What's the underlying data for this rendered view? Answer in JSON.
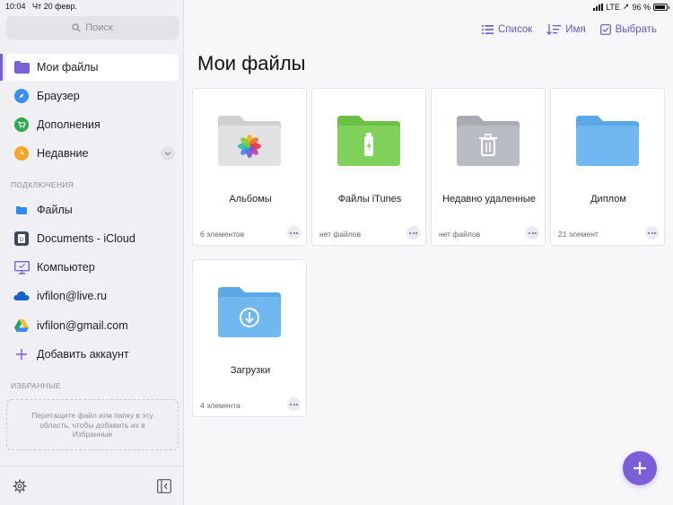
{
  "status": {
    "time": "10:04",
    "date": "Чт 20 февр.",
    "network": "LTE",
    "battery": "96 %"
  },
  "sidebar": {
    "search_placeholder": "Поиск",
    "items": [
      {
        "label": "Мои файлы",
        "icon": "folder-icon",
        "active": true
      },
      {
        "label": "Браузер",
        "icon": "compass-icon"
      },
      {
        "label": "Дополнения",
        "icon": "cart-icon"
      },
      {
        "label": "Недавние",
        "icon": "clock-icon"
      }
    ],
    "connections_label": "ПОДКЛЮЧЕНИЯ",
    "connections": [
      {
        "label": "Файлы",
        "icon": "files-folder-icon"
      },
      {
        "label": "Documents - iCloud",
        "icon": "documents-app-icon"
      },
      {
        "label": "Компьютер",
        "icon": "computer-icon"
      },
      {
        "label": "ivfilon@live.ru",
        "icon": "onedrive-cloud-icon"
      },
      {
        "label": "ivfilon@gmail.com",
        "icon": "google-drive-icon"
      },
      {
        "label": "Добавить аккаунт",
        "icon": "plus-icon"
      }
    ],
    "favorites_label": "ИЗБРАННЫЕ",
    "favorites_hint": "Перетащите файл или папку в эту область, чтобы добавить их в Избранные"
  },
  "toolbar": {
    "list_label": "Список",
    "sort_label": "Имя",
    "select_label": "Выбрать"
  },
  "main": {
    "title": "Мои файлы",
    "items": [
      {
        "name": "Альбомы",
        "meta": "6 элементов",
        "folder": "photos"
      },
      {
        "name": "Файлы iTunes",
        "meta": "нет файлов",
        "folder": "itunes"
      },
      {
        "name": "Недавно удаленные",
        "meta": "нет файлов",
        "folder": "trash"
      },
      {
        "name": "Диплом",
        "meta": "21 элемент",
        "folder": "plain"
      },
      {
        "name": "Загрузки",
        "meta": "4 элемента",
        "folder": "downloads"
      }
    ]
  },
  "colors": {
    "accent": "#7a5fd8",
    "folder_blue": "#6fb8f0",
    "folder_green": "#7fd15a",
    "folder_gray": "#b9bcc1",
    "folder_light": "#e2e2e4"
  }
}
